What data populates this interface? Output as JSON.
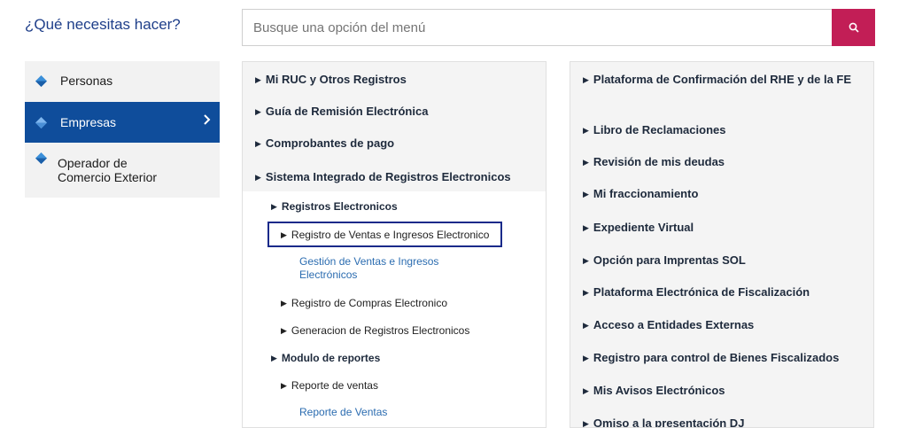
{
  "heading": "¿Qué necesitas hacer?",
  "search": {
    "placeholder": "Busque una opción del menú",
    "icon": "search-icon",
    "button_color": "#c21e56"
  },
  "left_nav": [
    {
      "label": "Personas",
      "active": false
    },
    {
      "label": "Empresas",
      "active": true
    },
    {
      "label": "Operador de\nComercio Exterior",
      "active": false
    }
  ],
  "middle": {
    "top_items": [
      "Mi RUC y Otros Registros",
      "Guía de Remisión Electrónica",
      "Comprobantes de pago",
      "Sistema Integrado de Registros Electronicos"
    ],
    "registros": "Registros Electronicos",
    "rve": "Registro de Ventas e Ingresos Electronico",
    "gestion": "Gestión de Ventas e Ingresos Electrónicos",
    "compras": "Registro de Compras Electronico",
    "generacion": "Generacion de Registros Electronicos",
    "modulo": "Modulo de reportes",
    "reporte": "Reporte de ventas",
    "reporte_link": "Reporte de Ventas"
  },
  "right": {
    "items": [
      "Plataforma de Confirmación del RHE y de la FE",
      "Libro de Reclamaciones",
      "Revisión de mis deudas",
      "Mi fraccionamiento",
      "Expediente Virtual",
      "Opción para Imprentas SOL",
      "Plataforma Electrónica de Fiscalización",
      "Acceso a Entidades Externas",
      "Registro para control de Bienes Fiscalizados",
      "Mis Avisos Electrónicos",
      "Omiso a la presentación DJ"
    ]
  },
  "colors": {
    "brand_blue": "#0f4d9b",
    "accent": "#c21e56",
    "link": "#2b6cb0"
  }
}
